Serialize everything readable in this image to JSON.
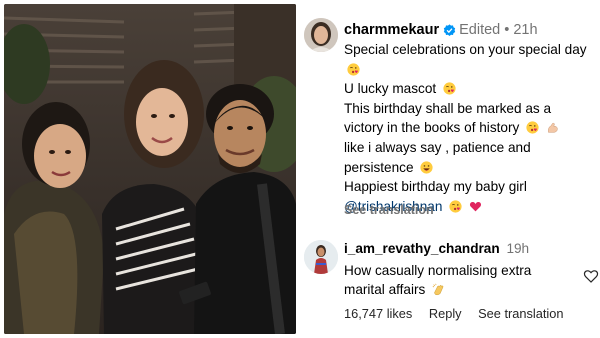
{
  "post": {
    "username": "charmmekaur",
    "edited_label": "Edited",
    "separator": "•",
    "time": "21h",
    "caption_lines": [
      "Special celebrations on your special day",
      "U lucky mascot",
      "This birthday shall be marked as a",
      "victory in the books of history",
      "like i always say , patience and",
      "persistence",
      "Happiest birthday my baby girl"
    ],
    "mention": "@trishakrishnan",
    "see_translation": "See translation",
    "icons": {
      "verified": "verified-badge-icon",
      "emoji_kiss": "face-blowing-kiss-emoji",
      "emoji_muscle": "flexed-biceps-emoji",
      "emoji_grin": "grinning-face-emoji",
      "emoji_heart": "heart-emoji"
    }
  },
  "reply": {
    "username": "i_am_revathy_chandran",
    "time": "19h",
    "text_lines": [
      "How casually normalising extra",
      "marital affairs"
    ],
    "likes": "16,747 likes",
    "reply_label": "Reply",
    "see_translation": "See translation",
    "icons": {
      "clap": "clapping-hands-emoji",
      "heart": "heart-outline-icon"
    }
  },
  "colors": {
    "text": "#000000",
    "muted": "#737373",
    "mention": "#00376b",
    "verified": "#0095f6"
  }
}
